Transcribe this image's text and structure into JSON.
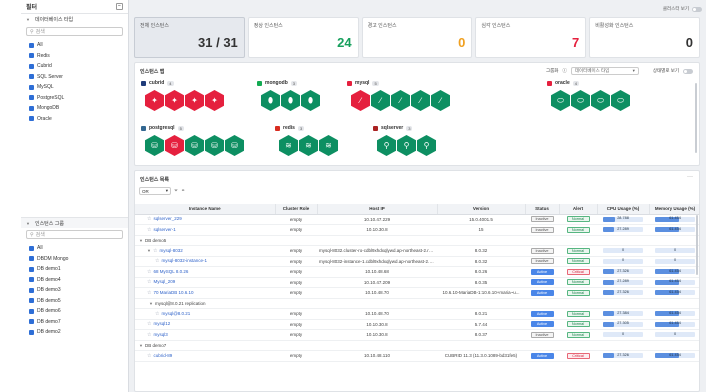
{
  "sidebar": {
    "title": "필터",
    "group1": {
      "label": "데이터베이스 타입",
      "search_placeholder": "검색",
      "items": [
        "All",
        "Redis",
        "Cubrid",
        "SQL Server",
        "MySQL",
        "PostgreSQL",
        "MongoDB",
        "Oracle"
      ]
    },
    "group2": {
      "label": "인스턴스 그룹",
      "search_placeholder": "검색",
      "items": [
        "All",
        "DBDM Mongo",
        "DB demo1",
        "DB demo4",
        "DB demo3",
        "DB demo5",
        "DB demo6",
        "DB demo7",
        "DB demo2"
      ]
    }
  },
  "top": {
    "toggle_label": "클러스터 보기"
  },
  "cards": [
    {
      "label": "전체 인스턴스",
      "value": "31 / 31",
      "color": "#333333"
    },
    {
      "label": "정상 인스턴스",
      "value": "24",
      "color": "#18a05e"
    },
    {
      "label": "경고 인스턴스",
      "value": "0",
      "color": "#f0a020"
    },
    {
      "label": "심각 인스턴스",
      "value": "7",
      "color": "#e5203e"
    },
    {
      "label": "비활성화 인스턴스",
      "value": "0",
      "color": "#333333"
    }
  ],
  "map": {
    "title": "인스턴스 맵",
    "group_label": "그룹화",
    "group_select": "데이터베이스 타입",
    "toggle_label": "상태별로 보기",
    "groups": [
      {
        "name": "cubrid",
        "count": "4",
        "hexes": [
          "r",
          "r",
          "r",
          "r"
        ],
        "glyph": "✦",
        "color": "#1f3c7a"
      },
      {
        "name": "mongodb",
        "count": "3",
        "hexes": [
          "g",
          "g",
          "g"
        ],
        "glyph": "⬮",
        "color": "#13aa52"
      },
      {
        "name": "mysql",
        "count": "5",
        "hexes": [
          "r",
          "g",
          "g",
          "g",
          "g"
        ],
        "glyph": "∕",
        "color": "#e5203e"
      },
      {
        "name": "oracle",
        "count": "4",
        "hexes": [
          "g",
          "g",
          "g",
          "g"
        ],
        "glyph": "⬭",
        "color": "#e5203e"
      },
      {
        "name": "postgresql",
        "count": "5",
        "hexes": [
          "g",
          "r",
          "g",
          "g",
          "g"
        ],
        "glyph": "⛁",
        "color": "#336791"
      },
      {
        "name": "redis",
        "count": "3",
        "hexes": [
          "g",
          "g",
          "g"
        ],
        "glyph": "≋",
        "color": "#d82c20"
      },
      {
        "name": "sqlserver",
        "count": "3",
        "hexes": [
          "g",
          "g",
          "g"
        ],
        "glyph": "⚲",
        "color": "#aa2222"
      }
    ]
  },
  "list": {
    "title": "인스턴스 목록",
    "filter_select": "OR",
    "columns": [
      "Instance Name",
      "Cluster Role",
      "Host IP",
      "Version",
      "Status",
      "Alert",
      "CPU Usage (%)",
      "Memory Usage (%)"
    ],
    "rows": [
      {
        "type": "inst",
        "indent": 1,
        "name": "sqlserver_229",
        "role": "empty",
        "ip": "10.10.47.229",
        "ver": "15.0.4001.5",
        "status": "Inactive",
        "alert": "Normal",
        "cpu": "28.788",
        "cpu_pct": 29,
        "mem": "61.454",
        "mem_pct": 61
      },
      {
        "type": "inst",
        "indent": 1,
        "name": "sqlserver-1",
        "role": "empty",
        "ip": "10.10.30.8",
        "ver": "15",
        "status": "Inactive",
        "alert": "Normal",
        "cpu": "27.289",
        "cpu_pct": 27,
        "mem": "61.454",
        "mem_pct": 61
      },
      {
        "type": "group",
        "indent": 0,
        "name": "DB demo5"
      },
      {
        "type": "inst",
        "indent": 1,
        "caret": true,
        "name": "mysql-8032",
        "role": "empty",
        "ip": "mysql-8032.cluster-ro-cdbl9xhdxqlywd.ap-northeast-2.rds.ama...",
        "ver": "8.0.32",
        "status": "Inactive",
        "alert": "Normal",
        "cpu": "0",
        "cpu_pct": 0,
        "mem": "0",
        "mem_pct": 0
      },
      {
        "type": "inst",
        "indent": 2,
        "name": "mysql-8032-instance-1",
        "role": "empty",
        "ip": "mysql-8032-instance-1.cdbl9xhdxqlywd.ap-northeast-2.rds.ama...",
        "ver": "8.0.32",
        "status": "Inactive",
        "alert": "Normal",
        "cpu": "0",
        "cpu_pct": 0,
        "mem": "0",
        "mem_pct": 0
      },
      {
        "type": "inst",
        "indent": 1,
        "name": "68 MySQL 8.0.26",
        "role": "empty",
        "ip": "10.10.48.68",
        "ver": "8.0.26",
        "status": "Active",
        "alert": "Critical",
        "cpu": "27.326",
        "cpu_pct": 27,
        "mem": "61.454",
        "mem_pct": 61
      },
      {
        "type": "inst",
        "indent": 1,
        "name": "Mysql_209",
        "role": "empty",
        "ip": "10.10.47.209",
        "ver": "8.0.35",
        "status": "Active",
        "alert": "Normal",
        "cpu": "27.289",
        "cpu_pct": 27,
        "mem": "61.454",
        "mem_pct": 61
      },
      {
        "type": "inst",
        "indent": 1,
        "name": "70 MariaDB 10.6.10",
        "role": "empty",
        "ip": "10.10.48.70",
        "ver": "10.6.10-MariaDB-1:10.6.10+maria~u...",
        "status": "Active",
        "alert": "Normal",
        "cpu": "27.326",
        "cpu_pct": 27,
        "mem": "61.454",
        "mem_pct": 61
      },
      {
        "type": "group",
        "indent": 1,
        "name": "mysql@8.0.21 replication"
      },
      {
        "type": "inst",
        "indent": 2,
        "name": "mysql@8.0.21",
        "role": "empty",
        "ip": "10.10.48.70",
        "ver": "8.0.21",
        "status": "Active",
        "alert": "Normal",
        "cpu": "27.384",
        "cpu_pct": 27,
        "mem": "61.454",
        "mem_pct": 61
      },
      {
        "type": "inst",
        "indent": 1,
        "name": "mysql12",
        "role": "empty",
        "ip": "10.10.30.8",
        "ver": "5.7.44",
        "status": "Active",
        "alert": "Normal",
        "cpu": "27.305",
        "cpu_pct": 27,
        "mem": "61.454",
        "mem_pct": 61
      },
      {
        "type": "inst",
        "indent": 1,
        "name": "mysql3",
        "role": "empty",
        "ip": "10.10.30.8",
        "ver": "8.0.37",
        "status": "Inactive",
        "alert": "Normal",
        "cpu": "0",
        "cpu_pct": 0,
        "mem": "0",
        "mem_pct": 0
      },
      {
        "type": "group",
        "indent": 0,
        "name": "DB demo7"
      },
      {
        "type": "inst",
        "indent": 1,
        "name": "cubrid-89",
        "role": "empty",
        "ip": "10.10.48.110",
        "ver": "CUBRID 11.3 (11.3.0.1089-bd31fe5)",
        "status": "Active",
        "alert": "Critical",
        "cpu": "27.326",
        "cpu_pct": 27,
        "mem": "61.454",
        "mem_pct": 61
      }
    ]
  }
}
